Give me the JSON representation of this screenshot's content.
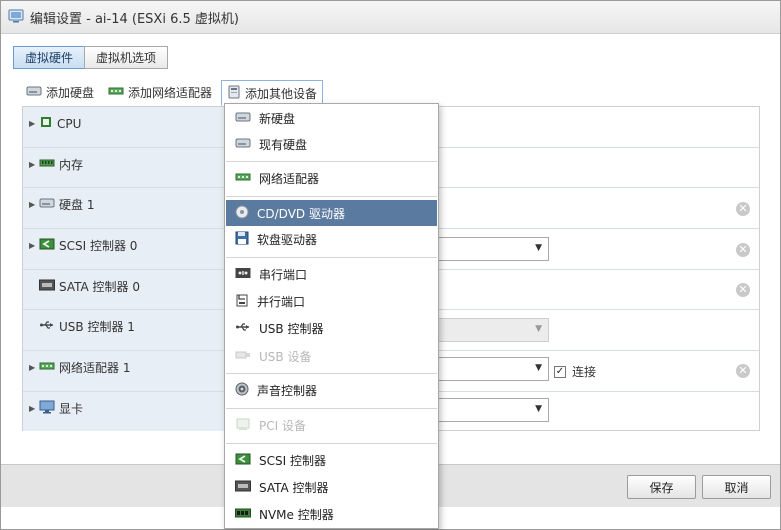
{
  "window": {
    "title": "编辑设置 - ai-14 (ESXi 6.5 虚拟机)"
  },
  "tabs": [
    {
      "label": "虚拟硬件",
      "active": true
    },
    {
      "label": "虚拟机选项",
      "active": false
    }
  ],
  "toolbar": {
    "add_disk": "添加硬盘",
    "add_nic": "添加网络适配器",
    "add_other": "添加其他设备"
  },
  "hardware": [
    {
      "label": "CPU",
      "expandable": true,
      "icon": "cpu-icon"
    },
    {
      "label": "内存",
      "expandable": true,
      "icon": "memory-icon"
    },
    {
      "label": "硬盘 1",
      "expandable": true,
      "icon": "hard-disk-icon"
    },
    {
      "label": "SCSI 控制器 0",
      "expandable": true,
      "icon": "scsi-controller-icon"
    },
    {
      "label": "SATA 控制器 0",
      "expandable": false,
      "icon": "sata-controller-icon"
    },
    {
      "label": "USB 控制器 1",
      "expandable": false,
      "icon": "usb-icon"
    },
    {
      "label": "网络适配器 1",
      "expandable": true,
      "icon": "network-adapter-icon"
    },
    {
      "label": "显卡",
      "expandable": true,
      "icon": "monitor-icon"
    }
  ],
  "nic_connect": {
    "label": "连接",
    "checked": true
  },
  "dropdown_menu": {
    "items": [
      {
        "label": "新硬盘",
        "icon": "hard-disk-icon",
        "state": "normal"
      },
      {
        "label": "现有硬盘",
        "icon": "hard-disk-icon",
        "state": "normal"
      },
      {
        "label": "网络适配器",
        "icon": "network-adapter-icon",
        "state": "normal"
      },
      {
        "label": "CD/DVD 驱动器",
        "icon": "cd-dvd-icon",
        "state": "selected"
      },
      {
        "label": "软盘驱动器",
        "icon": "floppy-icon",
        "state": "normal"
      },
      {
        "label": "串行端口",
        "icon": "serial-port-icon",
        "state": "normal"
      },
      {
        "label": "并行端口",
        "icon": "parallel-port-icon",
        "state": "normal"
      },
      {
        "label": "USB 控制器",
        "icon": "usb-icon",
        "state": "normal"
      },
      {
        "label": "USB 设备",
        "icon": "usb-device-icon",
        "state": "disabled"
      },
      {
        "label": "声音控制器",
        "icon": "sound-icon",
        "state": "normal"
      },
      {
        "label": "PCI 设备",
        "icon": "pci-icon",
        "state": "disabled"
      },
      {
        "label": "SCSI 控制器",
        "icon": "scsi-controller-icon",
        "state": "normal"
      },
      {
        "label": "SATA 控制器",
        "icon": "sata-controller-icon",
        "state": "normal"
      },
      {
        "label": "NVMe 控制器",
        "icon": "nvme-controller-icon",
        "state": "normal"
      }
    ]
  },
  "footer": {
    "save_label": "保存",
    "cancel_label": "取消"
  },
  "colors": {
    "accent": "#5b7aa0",
    "active_tab": "#c9def2",
    "hardware_label_bg": "#e7eef5"
  }
}
